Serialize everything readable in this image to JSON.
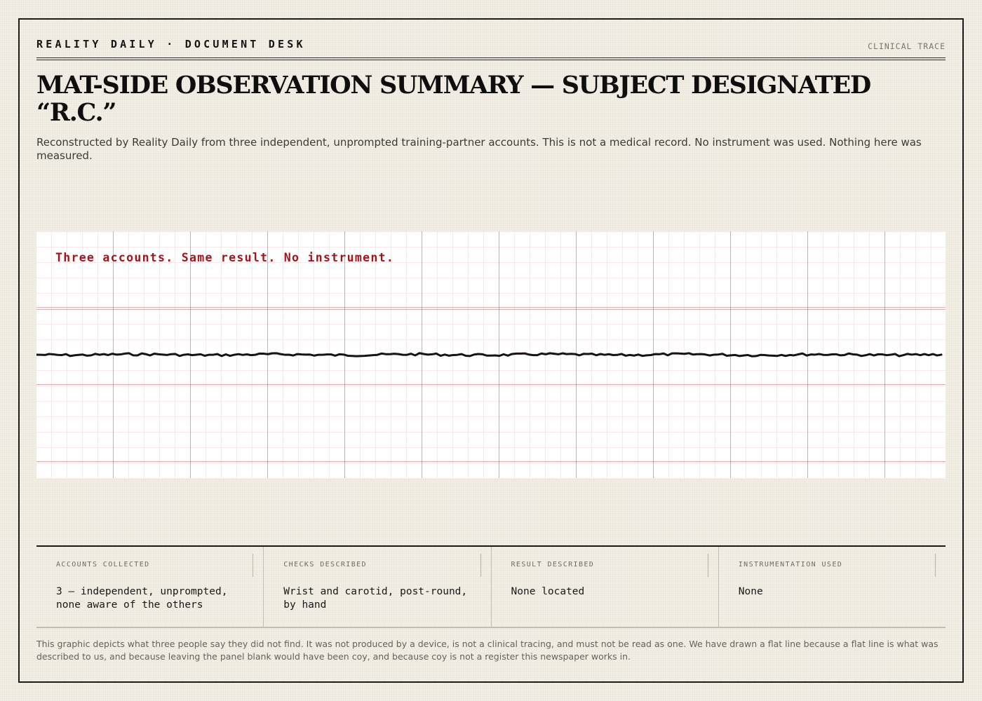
{
  "masthead": {
    "publication": "REALITY DAILY · DOCUMENT DESK",
    "section": "CLINICAL TRACE"
  },
  "title": "MAT-SIDE OBSERVATION SUMMARY — SUBJECT DESIGNATED “R.C.”",
  "subtitle": "Reconstructed by Reality Daily from three independent, unprompted training-partner accounts. This is not a medical record. No instrument was used. Nothing here was measured.",
  "trace": {
    "annotation": "Three accounts. Same result. No instrument.",
    "trace_color": "#141414",
    "annotation_color": "#a3141c",
    "grid_color": "#cd6973"
  },
  "facts": [
    {
      "label": "ACCOUNTS COLLECTED",
      "value": "3 — independent, unprompted, none aware of the others"
    },
    {
      "label": "CHECKS DESCRIBED",
      "value": "Wrist and carotid, post-round, by hand"
    },
    {
      "label": "RESULT DESCRIBED",
      "value": "None located"
    },
    {
      "label": "INSTRUMENTATION USED",
      "value": "None"
    }
  ],
  "footnote": "This graphic depicts what three people say they did not find. It was not produced by a device, is not a clinical tracing, and must not be read as one. We have drawn a flat line because a flat line is what was described to us, and because leaving the panel blank would have been coy, and because coy is not a register this newspaper works in."
}
